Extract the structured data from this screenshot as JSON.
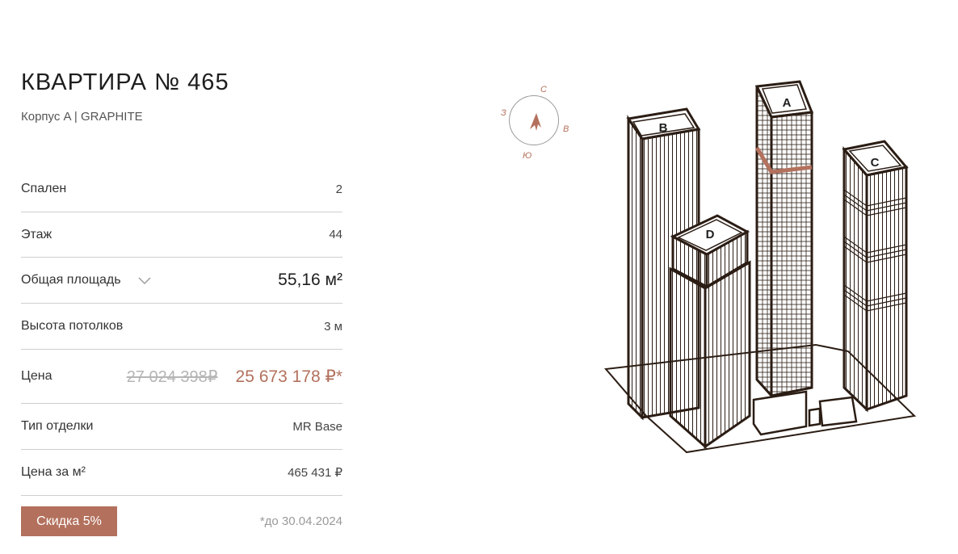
{
  "title": "КВАРТИРА № 465",
  "subtitle": "Корпус A | GRAPHITE",
  "details": {
    "bedrooms": {
      "label": "Спален",
      "value": "2"
    },
    "floor": {
      "label": "Этаж",
      "value": "44"
    },
    "area": {
      "label": "Общая площадь",
      "value": "55,16 м²"
    },
    "ceiling": {
      "label": "Высота потолков",
      "value": "3 м"
    },
    "price": {
      "label": "Цена",
      "old_value": "27 024 398₽",
      "new_value": "25 673 178 ₽*"
    },
    "finish": {
      "label": "Тип отделки",
      "value": "MR Base"
    },
    "price_per_m2": {
      "label": "Цена за м²",
      "value": "465 431 ₽"
    }
  },
  "discount": {
    "label": "Скидка 5%",
    "note": "*до 30.04.2024"
  },
  "compass": {
    "n": "С",
    "e": "В",
    "s": "Ю",
    "w": "З"
  },
  "towers": {
    "a": "A",
    "b": "B",
    "c": "C",
    "d": "D"
  },
  "colors": {
    "accent": "#b3715d",
    "line": "#2b1d14",
    "divider": "#cfcfcf"
  }
}
